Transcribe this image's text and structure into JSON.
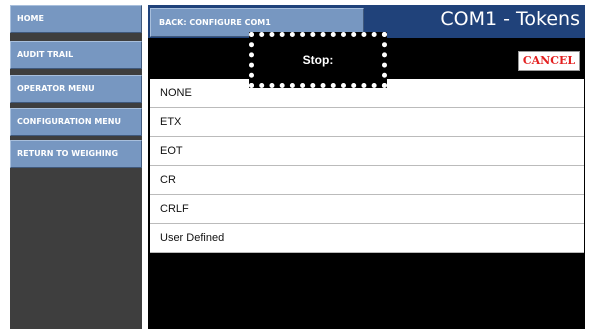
{
  "sidebar": {
    "items": [
      {
        "label": "HOME"
      },
      {
        "label": "AUDIT TRAIL"
      },
      {
        "label": "OPERATOR MENU"
      },
      {
        "label": "CONFIGURATION MENU"
      },
      {
        "label": "RETURN TO WEIGHING"
      }
    ]
  },
  "header": {
    "back_label": "BACK: CONFIGURE COM1",
    "title": "COM1 - Tokens"
  },
  "cancel_label": "CANCEL",
  "prompt_label": "Stop:",
  "options": [
    "NONE",
    "ETX",
    "EOT",
    "CR",
    "CRLF",
    "User Defined"
  ],
  "colors": {
    "sidebar_button": "#7797c1",
    "header_bar": "#20427a",
    "background": "#000000",
    "cancel_text": "#e32020"
  }
}
